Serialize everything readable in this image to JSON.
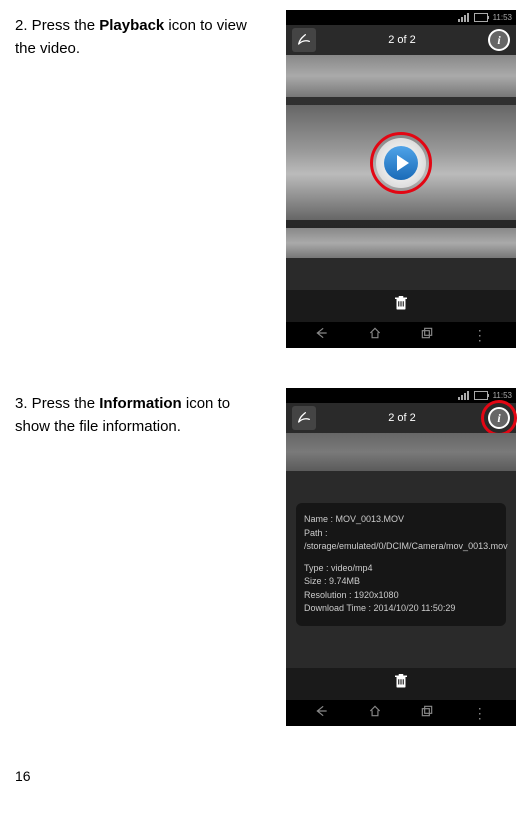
{
  "step2": {
    "num": "2.",
    "text_before": " Press the ",
    "bold": "Playback",
    "text_after": " icon to view the video."
  },
  "step3": {
    "num": "3.",
    "text_before": " Press the ",
    "bold": "Information",
    "text_after": " icon to show the file information."
  },
  "screenshot1": {
    "status_time": "11:53",
    "header_counter": "2 of 2",
    "info_glyph": "i"
  },
  "screenshot2": {
    "status_time": "11:53",
    "header_counter": "2 of 2",
    "info_glyph": "i",
    "info_panel": {
      "name": "Name : MOV_0013.MOV",
      "path": "Path : /storage/emulated/0/DCIM/Camera/mov_0013.mov",
      "type": "Type : video/mp4",
      "size": "Size : 9.74MB",
      "resolution": "Resolution : 1920x1080",
      "download_time": "Download Time : 2014/10/20 11:50:29"
    }
  },
  "page_number": "16"
}
